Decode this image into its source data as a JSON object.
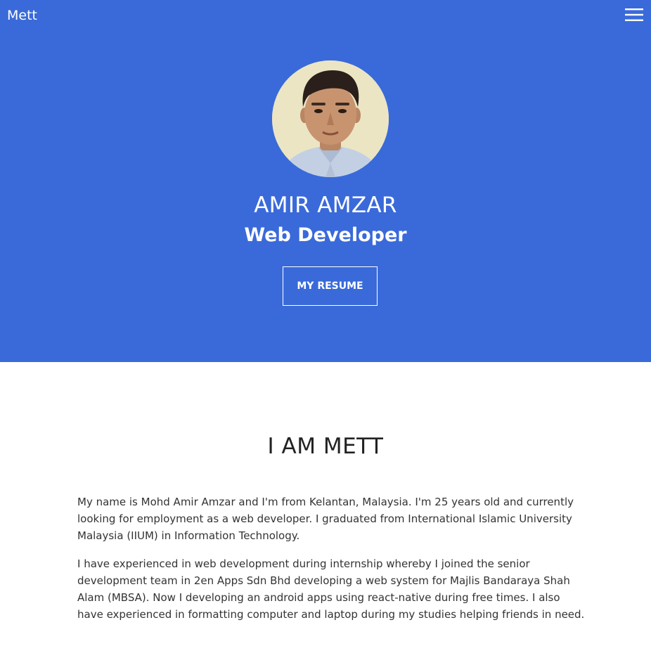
{
  "navbar": {
    "brand": "Mett",
    "menu_icon": "hamburger-menu-icon"
  },
  "hero": {
    "avatar_icon": "profile-photo",
    "name": "AMIR AMZAR",
    "role": "Web Developer",
    "resume_button": "MY RESUME",
    "colors": {
      "background": "#3a6ad9",
      "text": "#ffffff"
    }
  },
  "about": {
    "title": "I AM METT",
    "paragraphs": [
      "My name is Mohd Amir Amzar and I'm from Kelantan, Malaysia. I'm 25 years old and currently looking for employment as a web developer. I graduated from International Islamic University Malaysia (IIUM) in Information Technology.",
      "I have experienced in web development during internship whereby I joined the senior development team in 2en Apps Sdn Bhd developing a web system for Majlis Bandaraya Shah Alam (MBSA). Now I developing an android apps using react-native during free times. I also have experienced in formatting computer and laptop during my studies helping friends in need."
    ]
  }
}
